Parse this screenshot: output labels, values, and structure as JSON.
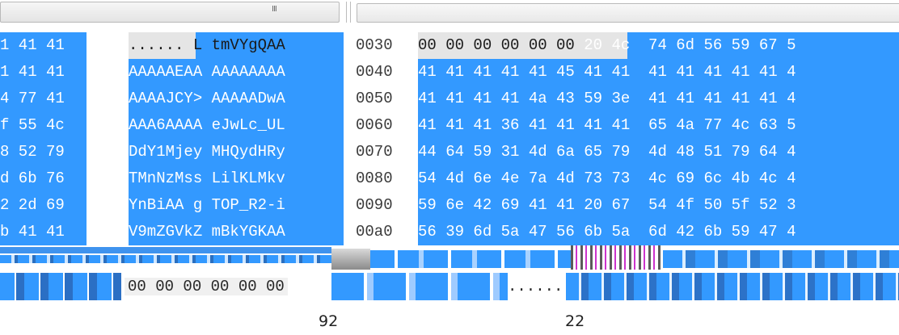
{
  "top_bar": {
    "left_grip": "III"
  },
  "left_pane": {
    "hex_rows": [
      "1 41 41",
      "1 41 41",
      "4 77 41",
      "f 55 4c",
      "8 52 79",
      "d 6b 76",
      "2 2d 69",
      "b 41 41"
    ],
    "ascii_rows": [
      "...... L tmVYgQAA",
      "AAAAAEAA AAAAAAAA",
      "AAAAJCY> AAAAADwA",
      "AAA6AAAA eJwLc_UL",
      "DdY1Mjey MHQydHRy",
      "TMnNzMss LilKLMkv",
      "YnBiAA g TOP_R2-i",
      "V9mZGVkZ mBkYGKAA"
    ]
  },
  "offsets": [
    "0030",
    "0040",
    "0050",
    "0060",
    "0070",
    "0080",
    "0090",
    "00a0"
  ],
  "right_pane": {
    "hex_rows": [
      "00 00 00 00 00 00 20 4c  74 6d 56 59 67 5",
      "41 41 41 41 41 45 41 41  41 41 41 41 41 4",
      "41 41 41 41 4a 43 59 3e  41 41 41 41 41 4",
      "41 41 41 36 41 41 41 41  65 4a 77 4c 63 5",
      "44 64 59 31 4d 6a 65 79  4d 48 51 79 64 4",
      "54 4d 6e 4e 7a 4d 73 73  4c 69 6c 4b 4c 4",
      "59 6e 42 69 41 41 20 67  54 4f 50 5f 52 3",
      "56 39 6d 5a 47 56 6b 5a  6d 42 6b 59 47 4"
    ],
    "first_row_selection": "00 00 00 00 00 00"
  },
  "glitch_strip": {
    "zero_run": "00 00 00 00 00 00",
    "dots": "......"
  },
  "captions": {
    "left": "92",
    "right": "22"
  },
  "colors": {
    "selection_blue": "#3399ff",
    "selection_gray": "#e5e5e5"
  }
}
